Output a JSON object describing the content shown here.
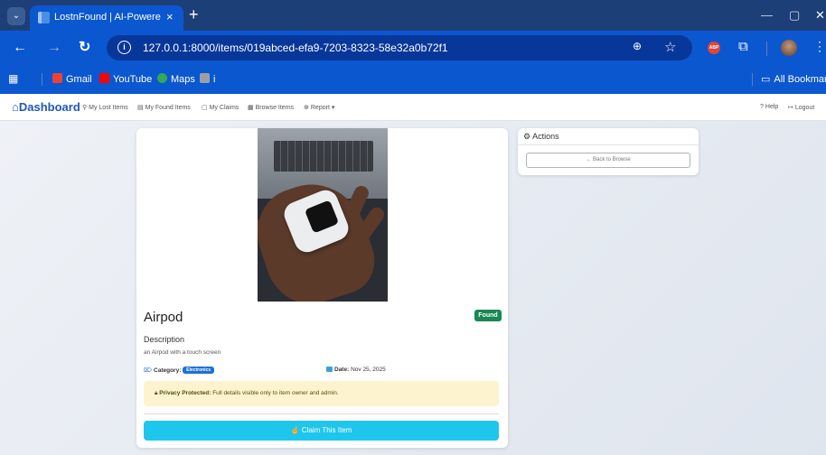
{
  "browser": {
    "tab_title": "LostnFound | AI-Powered Lo",
    "tab_close": "×",
    "new_tab": "+",
    "url": "127.0.0.1:8000/items/019abced-efa9-7203-8323-58e32a0b72f1",
    "abp_label": "ABP",
    "bookmarks": [
      {
        "label": "Gmail",
        "color": "#ea4335"
      },
      {
        "label": "YouTube",
        "color": "#ff0000"
      },
      {
        "label": "Maps",
        "color": "#34a853"
      },
      {
        "label": "i",
        "color": "#9aa0a6"
      }
    ],
    "all_bookmarks": "All Bookmarks"
  },
  "nav": {
    "brand": "Dashboard",
    "links": [
      {
        "icon": "search-icon",
        "label": "My Lost Items"
      },
      {
        "icon": "inbox-icon",
        "label": "My Found Items"
      },
      {
        "icon": "clipboard-icon",
        "label": "My Claims"
      },
      {
        "icon": "grid-icon",
        "label": "Browse Items"
      },
      {
        "icon": "plus-circle-icon",
        "label": "Report"
      }
    ],
    "report_caret": "▾",
    "help": "Help",
    "logout": "Logout"
  },
  "item": {
    "title": "Airpod",
    "status": "Found",
    "description_heading": "Description",
    "description": "an Airpod with a touch screen",
    "category_label": "Category:",
    "category_value": "Electronics",
    "date_label": "Date:",
    "date_value": "Nov 25, 2025",
    "privacy_label": "Privacy Protected:",
    "privacy_text": "Full details visible only to item owner and admin.",
    "claim_button": "Claim This Item"
  },
  "actions": {
    "heading": "Actions",
    "back_button": "← Back to Browse"
  },
  "colors": {
    "brand_blue": "#1e58b8",
    "found_green": "#198754",
    "claim_cyan": "#1ec6ee",
    "privacy_bg": "#fdf3cf"
  }
}
